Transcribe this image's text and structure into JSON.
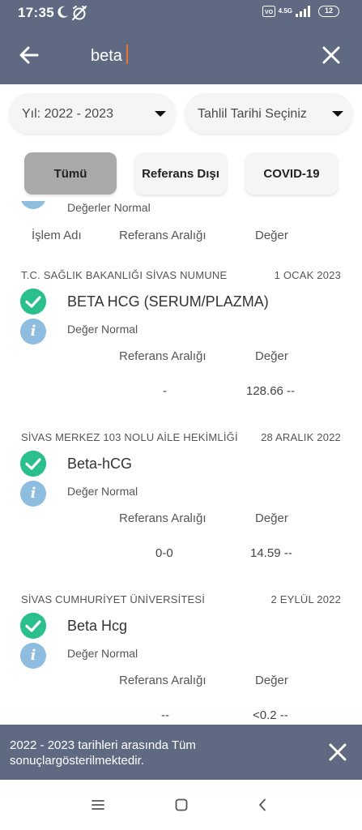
{
  "status_bar": {
    "time": "17:35",
    "network": "4.5G",
    "battery": "12"
  },
  "search": {
    "value": "beta"
  },
  "filters": {
    "year": "Yıl: 2022 - 2023",
    "date": "Tahlil Tarihi Seçiniz"
  },
  "tabs": [
    {
      "label": "Tümü",
      "selected": true
    },
    {
      "label": "Referans Dışı",
      "selected": false
    },
    {
      "label": "COVID-19",
      "selected": false
    }
  ],
  "partial_item": {
    "status": "Değerler Normal",
    "col_name": "İşlem Adı",
    "col_ref": "Referans Aralığı",
    "col_val": "Değer"
  },
  "results": [
    {
      "hospital": "T.C. SAĞLIK BAKANLIĞI SİVAS NUMUNE",
      "date": "1 OCAK 2023",
      "test": "BETA HCG (SERUM/PLAZMA)",
      "status": "Değer Normal",
      "col_ref": "Referans Aralığı",
      "col_val": "Değer",
      "ref": "-",
      "value": "128.66 --"
    },
    {
      "hospital": "SİVAS MERKEZ 103 NOLU AİLE HEKİMLİĞİ",
      "date": "28 ARALIK 2022",
      "test": "Beta-hCG",
      "status": "Değer Normal",
      "col_ref": "Referans Aralığı",
      "col_val": "Değer",
      "ref": "0-0",
      "value": "14.59 --"
    },
    {
      "hospital": "SİVAS CUMHURİYET ÜNİVERSİTESİ",
      "date": "2 EYLÜL 2022",
      "test": "Beta Hcg",
      "status": "Değer Normal",
      "col_ref": "Referans Aralığı",
      "col_val": "Değer",
      "ref": "--",
      "value": "<0.2 --"
    }
  ],
  "snackbar": {
    "text": "2022 - 2023 tarihleri arasında Tüm sonuçlargösterilmektedir."
  },
  "colors": {
    "header": "#5f6a82",
    "check": "#2bbf8e",
    "info": "#8ebde0",
    "caret": "#e8742b",
    "selected_tab": "#a9a9ab"
  },
  "icons": {
    "status": [
      "moon-icon",
      "alarm-off-icon",
      "volte-icon",
      "signal-icon",
      "battery-icon"
    ],
    "header": [
      "back-arrow-icon",
      "close-icon"
    ],
    "nav": [
      "menu-icon",
      "home-icon",
      "back-icon"
    ]
  }
}
